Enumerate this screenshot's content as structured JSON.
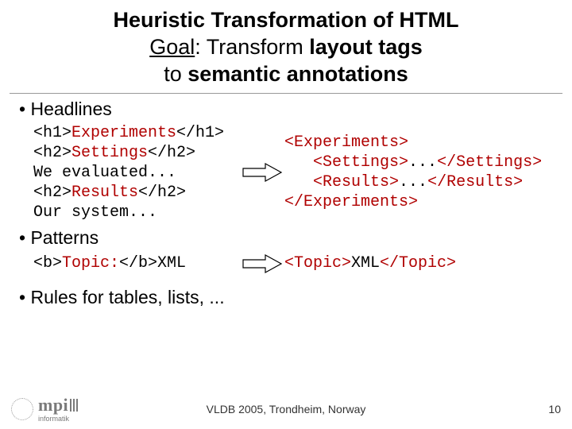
{
  "title": "Heuristic Transformation of HTML",
  "goal": {
    "label": "Goal",
    "line1_rest": ": Transform ",
    "line1_bold": "layout tags",
    "line2_pre": "to ",
    "line2_bold": "semantic annotations"
  },
  "bullets": {
    "headlines": "Headlines",
    "patterns": "Patterns",
    "rules": "Rules for tables, lists, ..."
  },
  "headlines_example": {
    "left": {
      "l1_open": "<h1>",
      "l1_text": "Experiments",
      "l1_close": "</h1>",
      "l2_open": "<h2>",
      "l2_text": "Settings",
      "l2_close": "</h2>",
      "l3": "We evaluated...",
      "l4_open": "<h2>",
      "l4_text": "Results",
      "l4_close": "</h2>",
      "l5": "Our system..."
    },
    "right": {
      "r1": "<Experiments>",
      "r2_indent": "   ",
      "r2_open": "<Settings>",
      "r2_dots": "...",
      "r2_close": "</Settings>",
      "r3_indent": "   ",
      "r3_open": "<Results>",
      "r3_dots": "...",
      "r3_close": "</Results>",
      "r4": "</Experiments>"
    }
  },
  "patterns_example": {
    "left": {
      "open": "<b>",
      "text": "Topic:",
      "close": "</b>",
      "tail": "XML"
    },
    "right": {
      "open": "<Topic>",
      "text": "XML",
      "close": "</Topic>"
    }
  },
  "footer": {
    "venue": "VLDB 2005, Trondheim, Norway",
    "page": "10"
  },
  "logo": {
    "text": "mpi",
    "sub": "informatik"
  }
}
